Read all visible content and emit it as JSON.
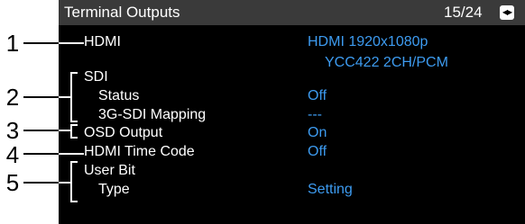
{
  "header": {
    "title": "Terminal Outputs",
    "page": "15/24",
    "page_icon": "page-flip-icon"
  },
  "rows": {
    "hdmi": {
      "label": "HDMI",
      "value_line1": "HDMI  1920x1080p",
      "value_line2": "YCC422  2CH/PCM"
    },
    "sdi": {
      "label": "SDI"
    },
    "sdi_status": {
      "label": "Status",
      "value": "Off"
    },
    "sdi_mapping": {
      "label": "3G-SDI Mapping",
      "value": "---"
    },
    "osd_output": {
      "label": "OSD Output",
      "value": "On"
    },
    "hdmi_timecode": {
      "label": "HDMI Time Code",
      "value": "Off"
    },
    "user_bit": {
      "label": "User Bit"
    },
    "user_bit_type": {
      "label": "Type",
      "value": "Setting"
    }
  },
  "callouts": [
    "1",
    "2",
    "3",
    "4",
    "5"
  ],
  "colors": {
    "screen_bg": "#000000",
    "title_bar": "#3a3a3a",
    "label_text": "#ffffff",
    "value_text": "#3d9bf0"
  }
}
